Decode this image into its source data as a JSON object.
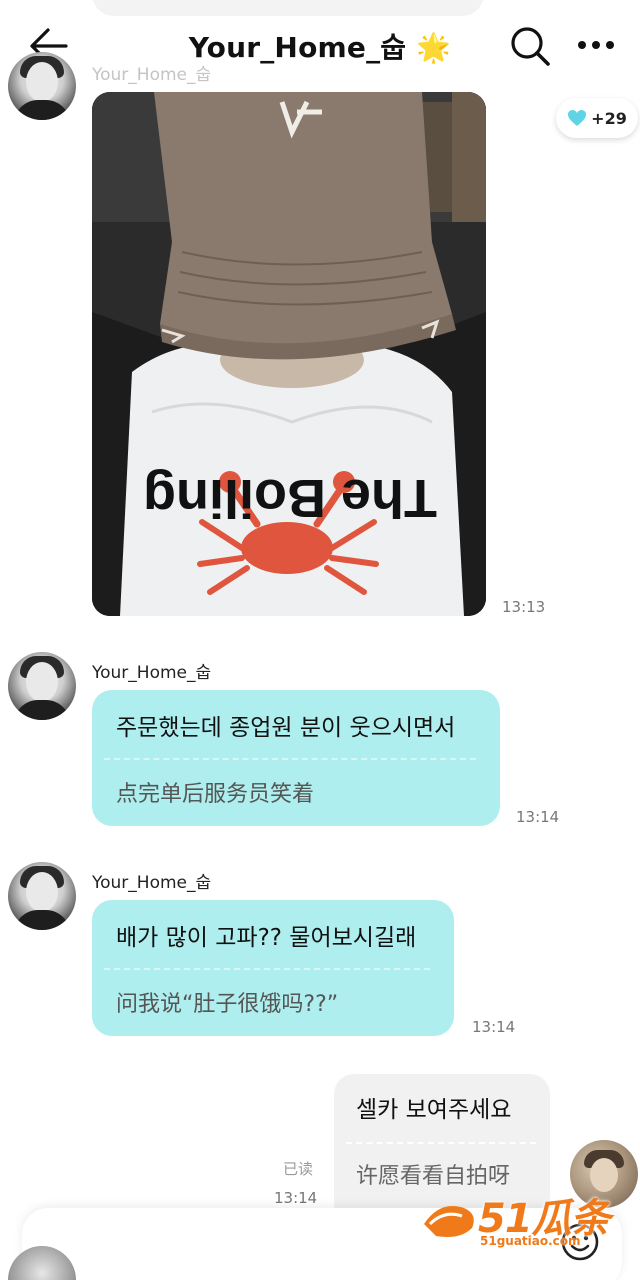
{
  "header": {
    "title": "Your_Home_숩 🌟",
    "back_icon": "arrow-left-icon",
    "search_icon": "search-icon",
    "more_icon": "more-dots-icon"
  },
  "reaction": {
    "icon": "heart-icon",
    "count": "+29",
    "color": "#5fd4e6"
  },
  "messages": [
    {
      "sender": "Your_Home_숩",
      "type": "image",
      "image_text": "The Boiling",
      "time": "13:13"
    },
    {
      "sender": "Your_Home_숩",
      "type": "text",
      "original": "주문했는데 종업원 분이 웃으시면서",
      "translation": "点完单后服务员笑着",
      "time": "13:14"
    },
    {
      "sender": "Your_Home_숩",
      "type": "text",
      "original": "배가 많이 고파?? 물어보시길래",
      "translation": "问我说“肚子很饿吗??”",
      "time": "13:14"
    },
    {
      "sender": "me",
      "type": "text",
      "original": "셀카 보여주세요",
      "translation": "许愿看看自拍呀",
      "read_status": "已读",
      "time": "13:14"
    }
  ],
  "input": {
    "emoji_icon": "smiley-icon"
  },
  "watermark": {
    "main": "51瓜条",
    "sub": "51guatiao.com"
  },
  "colors": {
    "bubble_received": "#aeeeef",
    "bubble_sent": "#f1f1f1",
    "watermark": "#f07a1a"
  }
}
